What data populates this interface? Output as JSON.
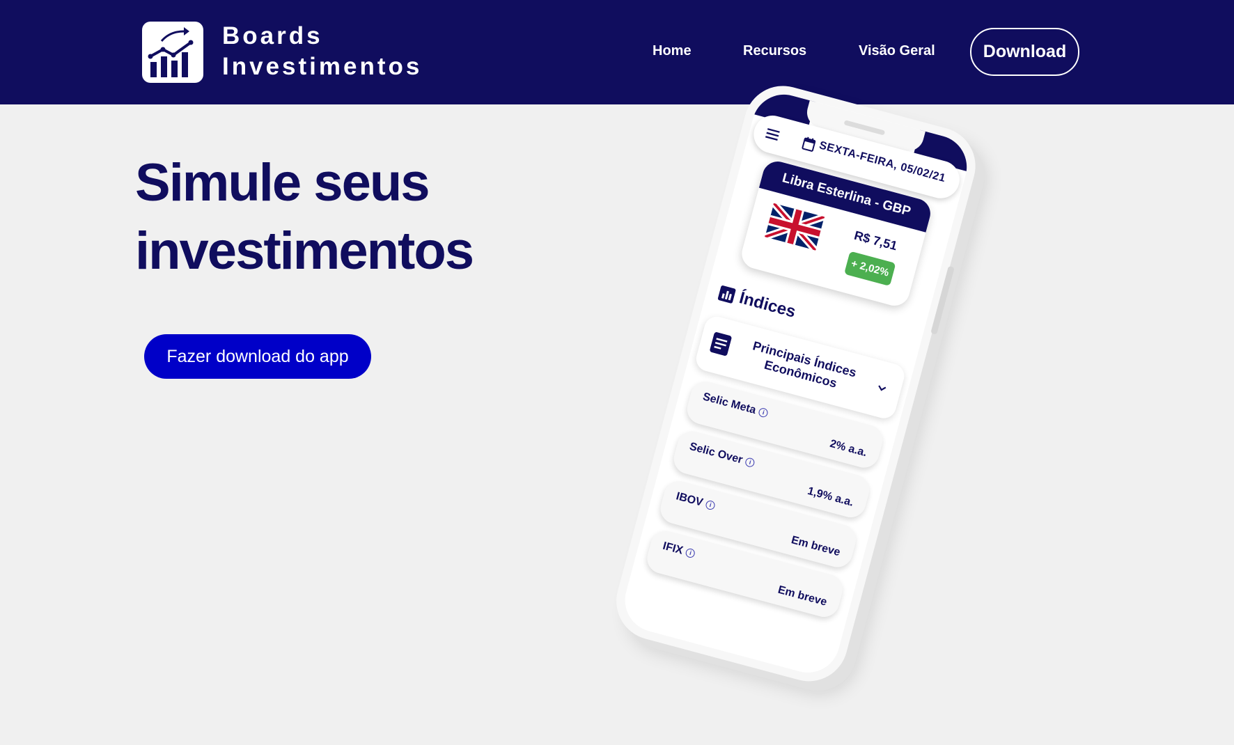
{
  "header": {
    "brand_line1": "Boards",
    "brand_line2": "Investimentos",
    "logo_icon": "growth-chart-icon",
    "nav": [
      {
        "label": "Home"
      },
      {
        "label": "Recursos"
      },
      {
        "label": "Visão Geral"
      }
    ],
    "download_label": "Download",
    "bg_color": "#100d5e"
  },
  "hero": {
    "title_line1": "Simule seus",
    "title_line2": "investimentos",
    "cta_label": "Fazer download do app",
    "cta_color": "#0000c8"
  },
  "phone": {
    "date": "SEXTA-FEIRA, 05/02/21",
    "menu_icon": "hamburger-menu-icon",
    "calendar_icon": "calendar-icon",
    "currency": {
      "title": "Libra Esterlina - GBP",
      "flag_icon": "uk-flag-icon",
      "price": "R$ 7,51",
      "change": "+ 2,02%"
    },
    "section_title": "Índices",
    "group_title": "Principais Índices Econômicos",
    "indices": [
      {
        "name": "Selic Meta",
        "value": "2% a.a."
      },
      {
        "name": "Selic Over",
        "value": "1,9% a.a."
      },
      {
        "name": "IBOV",
        "value": "Em breve"
      },
      {
        "name": "IFIX",
        "value": "Em breve"
      }
    ]
  }
}
